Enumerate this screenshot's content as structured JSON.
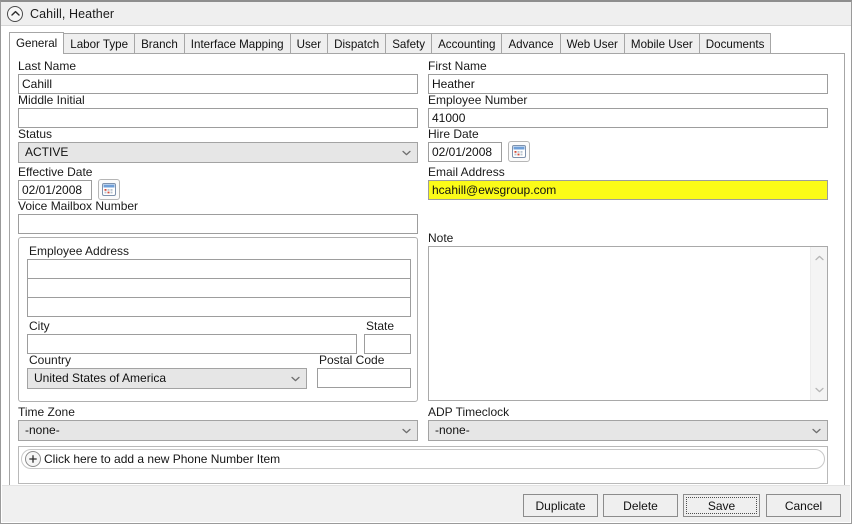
{
  "window": {
    "title": "Cahill, Heather",
    "collapse_icon": "chevron-up-circle-icon"
  },
  "tabs": [
    {
      "label": "General",
      "selected": true
    },
    {
      "label": "Labor Type",
      "selected": false
    },
    {
      "label": "Branch",
      "selected": false
    },
    {
      "label": "Interface Mapping",
      "selected": false
    },
    {
      "label": "User",
      "selected": false
    },
    {
      "label": "Dispatch",
      "selected": false
    },
    {
      "label": "Safety",
      "selected": false
    },
    {
      "label": "Accounting",
      "selected": false
    },
    {
      "label": "Advance",
      "selected": false
    },
    {
      "label": "Web User",
      "selected": false
    },
    {
      "label": "Mobile User",
      "selected": false
    },
    {
      "label": "Documents",
      "selected": false
    }
  ],
  "form": {
    "last_name": {
      "label": "Last Name",
      "value": "Cahill"
    },
    "middle_initial": {
      "label": "Middle Initial",
      "value": ""
    },
    "status": {
      "label": "Status",
      "value": "ACTIVE"
    },
    "effective_date": {
      "label": "Effective Date",
      "value": "02/01/2008",
      "button_icon": "calendar-icon"
    },
    "voice_mailbox": {
      "label": "Voice Mailbox Number",
      "value": ""
    },
    "first_name": {
      "label": "First Name",
      "value": "Heather"
    },
    "employee_number": {
      "label": "Employee Number",
      "value": "41000"
    },
    "hire_date": {
      "label": "Hire Date",
      "value": "02/01/2008",
      "button_icon": "calendar-icon"
    },
    "email_address": {
      "label": "Email Address",
      "value": "hcahill@ewsgroup.com",
      "highlight_color": "#fbfb18"
    },
    "note": {
      "label": "Note",
      "value": ""
    },
    "time_zone": {
      "label": "Time Zone",
      "value": "-none-"
    },
    "adp_timeclock": {
      "label": "ADP Timeclock",
      "value": "-none-"
    }
  },
  "address_group": {
    "title": "Employee Address",
    "line1": "",
    "line2": "",
    "line3": "",
    "city": {
      "label": "City",
      "value": ""
    },
    "state": {
      "label": "State",
      "value": ""
    },
    "country": {
      "label": "Country",
      "value": "United States of America"
    },
    "postal_code": {
      "label": "Postal Code",
      "value": ""
    }
  },
  "phone_panel": {
    "add_label": "Click here to add a new Phone Number Item",
    "add_icon": "plus-circle-icon"
  },
  "footer": {
    "duplicate": "Duplicate",
    "delete": "Delete",
    "save": "Save",
    "cancel": "Cancel",
    "focused_button": "Save"
  }
}
